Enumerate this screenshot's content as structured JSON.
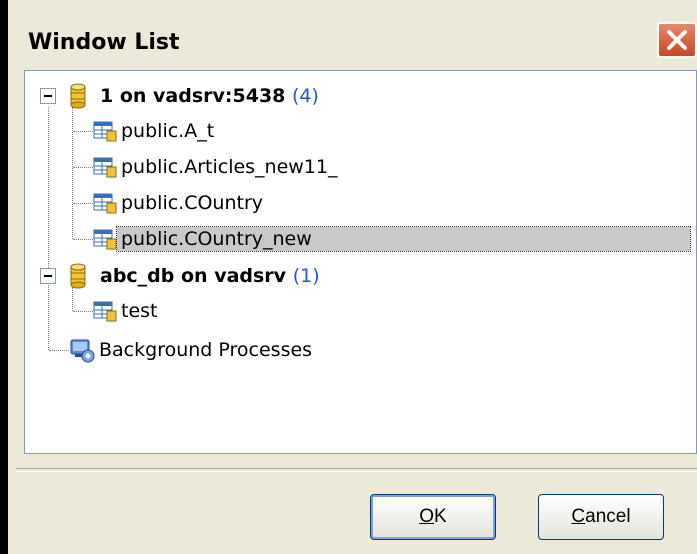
{
  "window": {
    "title": "Window List"
  },
  "tree": {
    "databases": [
      {
        "name": "1 on vadsrv:5438",
        "count": "(4)",
        "tables": [
          "public.A_t",
          "public.Articles_new11_",
          "public.COuntry",
          "public.COuntry_new"
        ],
        "selected_table": "public.COuntry_new"
      },
      {
        "name": "abc_db on vadsrv",
        "count": "(1)",
        "tables": [
          "test"
        ]
      }
    ],
    "background": "Background Processes"
  },
  "buttons": {
    "ok_first": "O",
    "ok_rest": "K",
    "cancel_first": "C",
    "cancel_rest": "ancel"
  },
  "colors": {
    "count": "#2255cc",
    "selection": "#c9c9c9",
    "close": "#c5471f"
  },
  "icons": {
    "database": "database-icon",
    "table": "table-icon",
    "process": "background-processes-icon"
  }
}
